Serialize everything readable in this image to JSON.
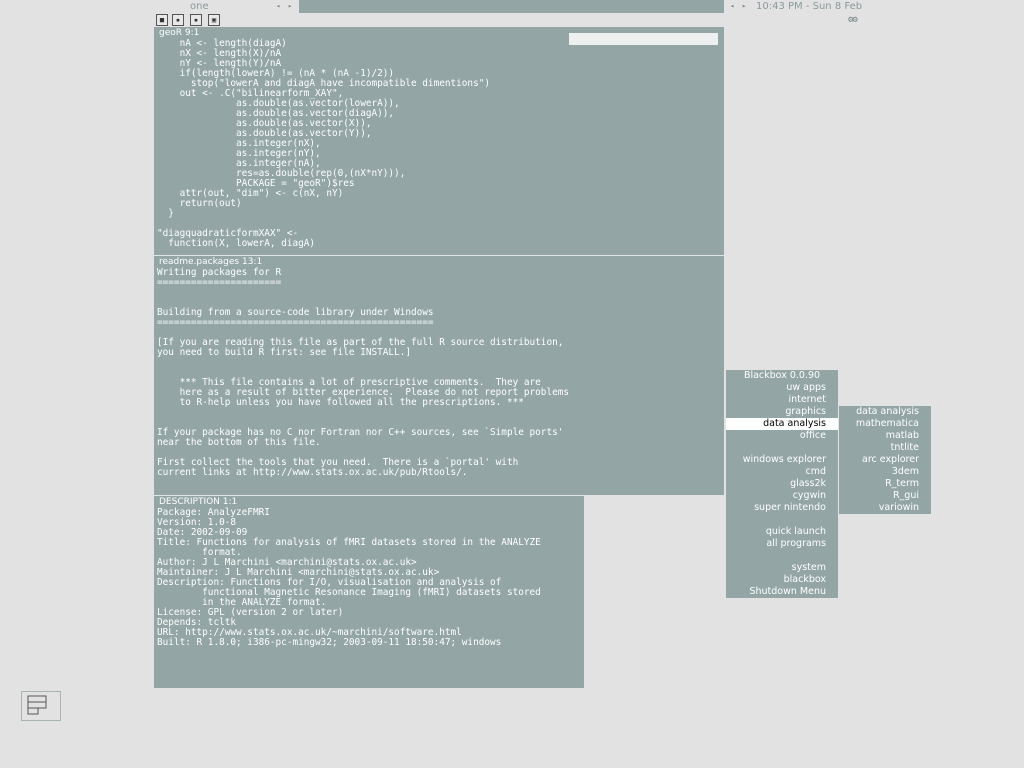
{
  "topbar": {
    "workspace": "one",
    "clock": "10:43 PM - Sun 8 Feb",
    "left_arrows": [
      "◂",
      "▸"
    ],
    "right_arrows": [
      "◂",
      "▸"
    ]
  },
  "window_buttons": [
    "iconify-icon",
    "shade-icon",
    "maximize-icon",
    "close-icon"
  ],
  "pane_geor": {
    "title": "geoR  9:1",
    "lines": [
      "    nA <- length(diagA)",
      "    nX <- length(X)/nA",
      "    nY <- length(Y)/nA",
      "    if(length(lowerA) != (nA * (nA -1)/2))",
      "      stop(\"lowerA and diagA have incompatible dimentions\")",
      "    out <- .C(\"bilinearform_XAY\",",
      "              as.double(as.vector(lowerA)),",
      "              as.double(as.vector(diagA)),",
      "              as.double(as.vector(X)),",
      "              as.double(as.vector(Y)),",
      "              as.integer(nX),",
      "              as.integer(nY),",
      "              as.integer(nA),",
      "              res=as.double(rep(0,(nX*nY))),",
      "              PACKAGE = \"geoR\")$res",
      "    attr(out, \"dim\") <- c(nX, nY)",
      "    return(out)",
      "  }",
      "",
      "\"diagquadraticformXAX\" <-",
      "  function(X, lowerA, diagA)"
    ]
  },
  "pane_readme": {
    "title": "readme.packages  13:1",
    "lines": [
      "Writing packages for R",
      "======================",
      "",
      "",
      "Building from a source-code library under Windows",
      "=================================================",
      "",
      "[If you are reading this file as part of the full R source distribution,",
      "you need to build R first: see file INSTALL.]",
      "",
      "",
      "    *** This file contains a lot of prescriptive comments.  They are",
      "    here as a result of bitter experience.  Please do not report problems",
      "    to R-help unless you have followed all the prescriptions. ***",
      "",
      "",
      "If your package has no C nor Fortran nor C++ sources, see `Simple ports'",
      "near the bottom of this file.",
      "",
      "First collect the tools that you need.  There is a `portal' with",
      "current links at http://www.stats.ox.ac.uk/pub/Rtools/."
    ]
  },
  "pane_description": {
    "title": " DESCRIPTION  1:1",
    "lines": [
      "Package: AnalyzeFMRI",
      "Version: 1.0-8",
      "Date: 2002-09-09",
      "Title: Functions for analysis of fMRI datasets stored in the ANALYZE",
      "        format.",
      "Author: J L Marchini <marchini@stats.ox.ac.uk>",
      "Maintainer: J L Marchini <marchini@stats.ox.ac.uk>",
      "Description: Functions for I/O, visualisation and analysis of",
      "        functional Magnetic Resonance Imaging (fMRI) datasets stored",
      "        in the ANALYZE format.",
      "License: GPL (version 2 or later)",
      "Depends: tcltk",
      "URL: http://www.stats.ox.ac.uk/~marchini/software.html",
      "Built: R 1.8.0; i386-pc-mingw32; 2003-09-11 18:50:47; windows"
    ]
  },
  "root_menu": {
    "title": "Blackbox 0.0.90",
    "items": [
      {
        "label": "uw apps"
      },
      {
        "label": "internet"
      },
      {
        "label": "graphics"
      },
      {
        "label": "data analysis",
        "selected": true
      },
      {
        "label": "office"
      },
      {
        "label": ""
      },
      {
        "label": "windows explorer"
      },
      {
        "label": "cmd"
      },
      {
        "label": "glass2k"
      },
      {
        "label": "cygwin"
      },
      {
        "label": "super nintendo"
      },
      {
        "label": ""
      },
      {
        "label": "quick launch"
      },
      {
        "label": "all programs"
      },
      {
        "label": ""
      },
      {
        "label": "system"
      },
      {
        "label": "blackbox"
      },
      {
        "label": "Shutdown Menu"
      }
    ]
  },
  "sub_menu": {
    "title": "data analysis",
    "items": [
      {
        "label": "mathematica"
      },
      {
        "label": "matlab"
      },
      {
        "label": "tntlite"
      },
      {
        "label": "arc explorer"
      },
      {
        "label": "3dem"
      },
      {
        "label": "R_term"
      },
      {
        "label": "R_gui"
      },
      {
        "label": "variowin"
      }
    ]
  }
}
